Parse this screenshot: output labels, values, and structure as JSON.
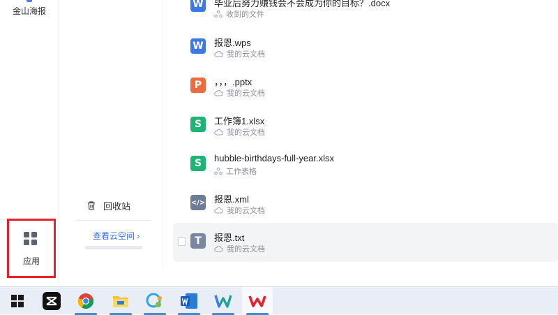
{
  "rail": {
    "items": [
      {
        "label": "金山海报"
      }
    ],
    "apps": {
      "label": "应用"
    }
  },
  "col2": {
    "recycle_label": "回收站",
    "cloud_link": "查看云空间",
    "cloud_chevron": "›"
  },
  "files": [
    {
      "name": "毕业后努力赚钱会不会成为你的目标？.docx",
      "location": "收到的文件",
      "type": "word",
      "glyph": "W",
      "loc_icon": "share-icon"
    },
    {
      "name": "报恩.wps",
      "location": "我的云文档",
      "type": "word",
      "glyph": "W",
      "loc_icon": "cloud-icon"
    },
    {
      "name": "，，，.pptx",
      "location": "我的云文档",
      "type": "ppt",
      "glyph": "P",
      "loc_icon": "cloud-icon"
    },
    {
      "name": "工作簿1.xlsx",
      "location": "我的云文档",
      "type": "sheet",
      "glyph": "S",
      "loc_icon": "cloud-icon"
    },
    {
      "name": "hubble-birthdays-full-year.xlsx",
      "location": "工作表格",
      "type": "sheet",
      "glyph": "S",
      "loc_icon": "share-icon"
    },
    {
      "name": "报恩.xml",
      "location": "我的云文档",
      "type": "xml",
      "glyph": "</>",
      "loc_icon": "cloud-icon"
    },
    {
      "name": "报恩.txt",
      "location": "我的云文档",
      "type": "text",
      "glyph": "T",
      "loc_icon": "cloud-icon"
    }
  ],
  "taskbar": {
    "apps": [
      "windows-start",
      "capcut",
      "chrome",
      "file-explorer",
      "chat-app",
      "microsoft-word",
      "wps-writer",
      "wps-office"
    ]
  },
  "colors": {
    "accent": "#3f73e6",
    "highlight_box": "#e8202a",
    "word": "#3c78e6",
    "ppt": "#ec6c3e",
    "sheet": "#1eb474"
  }
}
